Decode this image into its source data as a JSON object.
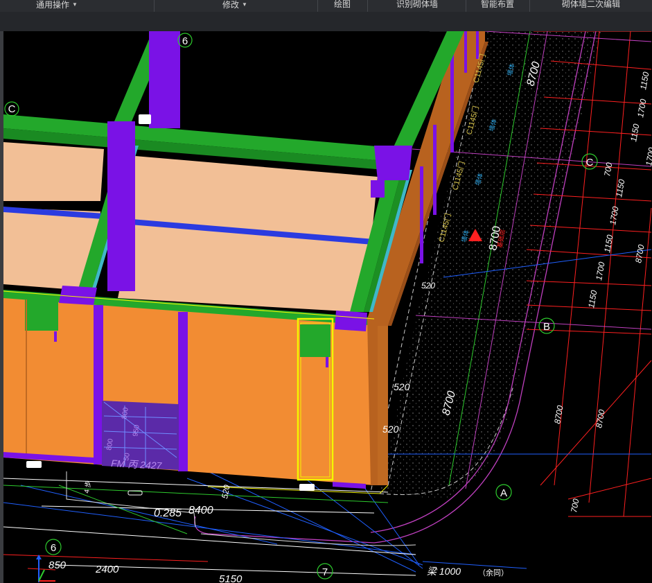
{
  "ribbon": {
    "groups": [
      {
        "label": "通用操作",
        "dropdown": true
      },
      {
        "label": "修改",
        "dropdown": true
      },
      {
        "label": "绘图",
        "dropdown": false
      },
      {
        "label": "识别砌体墙",
        "dropdown": false
      },
      {
        "label": "智能布置",
        "dropdown": false
      },
      {
        "label": "砌体墙二次编辑",
        "dropdown": false
      }
    ]
  },
  "viewport": {
    "axis_labels": {
      "c_left": "C",
      "c_right": "C",
      "b_right": "B",
      "a_right": "A",
      "six_top": "6",
      "six_bottom": "6",
      "seven_bottom": "7"
    },
    "dimensions": {
      "d8700_top": "8700",
      "d8700_mid": "8700",
      "d8700_lower": "8700",
      "d8700_vert1": "8700",
      "d8700_vert2": "8700",
      "d8700_edge": "8700",
      "d8400": "8400",
      "d2400": "2400",
      "d850": "850",
      "d5150": "5150",
      "d520_a": "520",
      "d520_b": "520",
      "d520_c": "520",
      "d520_d": "520",
      "d1150_list": [
        "1150",
        "1150",
        "1150",
        "1150",
        "1150"
      ],
      "d1700_list": [
        "1700",
        "1700",
        "1700",
        "1700"
      ],
      "d700_list": [
        "700",
        "700"
      ],
      "d1000": "1000",
      "slope": "0.285"
    },
    "annotations": {
      "window_tag": "C1145门",
      "window_tag_short": "C1145门",
      "door_label": "FM 丙  2427",
      "beam_note": "梁 1000",
      "beam_note_extra": "（余同）",
      "step_label": "4 步",
      "red_marker_text": "8700",
      "red_marker_sub": "基础层",
      "door_dim_800_a": "800",
      "door_dim_950": "950",
      "door_dim_800_b": "800",
      "door_dim_50": "50",
      "blue_tag": "墙体"
    },
    "colors": {
      "background": "#000000",
      "wall_orange": "#f28c33",
      "wall_side": "#b8621f",
      "beam_green": "#23a82b",
      "column_purple": "#7a12e6",
      "slab_tan": "#f2bf96",
      "highlight_yellow": "#f5f500",
      "dim_red": "#ff2020",
      "grid_magenta": "#c040c0"
    }
  }
}
